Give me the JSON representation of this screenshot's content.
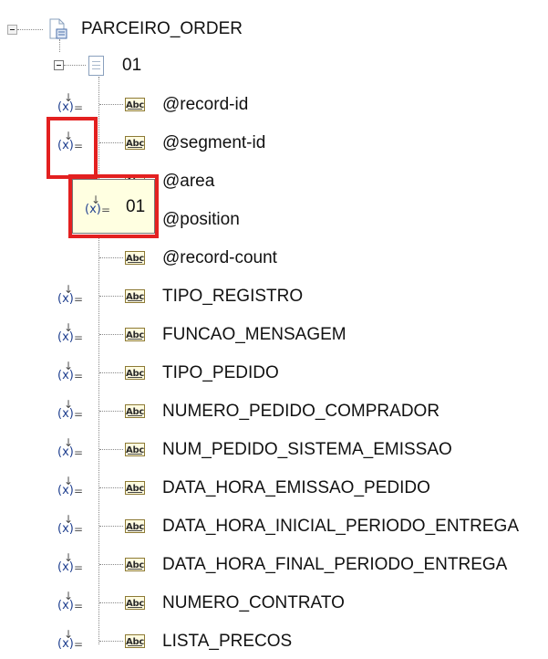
{
  "tree": {
    "root": {
      "label": "PARCEIRO_ORDER",
      "icon": "schema-document-icon"
    },
    "segment": {
      "label": "01",
      "icon": "document-icon",
      "expanded": true
    },
    "fields": [
      {
        "label": "@record-id",
        "mapped": true
      },
      {
        "label": "@segment-id",
        "mapped": true
      },
      {
        "label": "@area",
        "mapped": false
      },
      {
        "label": "@position",
        "mapped": false
      },
      {
        "label": "@record-count",
        "mapped": false
      },
      {
        "label": "TIPO_REGISTRO",
        "mapped": true
      },
      {
        "label": "FUNCAO_MENSAGEM",
        "mapped": true
      },
      {
        "label": "TIPO_PEDIDO",
        "mapped": true
      },
      {
        "label": "NUMERO_PEDIDO_COMPRADOR",
        "mapped": true
      },
      {
        "label": "NUM_PEDIDO_SISTEMA_EMISSAO",
        "mapped": true
      },
      {
        "label": "DATA_HORA_EMISSAO_PEDIDO",
        "mapped": true
      },
      {
        "label": "DATA_HORA_INICIAL_PERIODO_ENTREGA",
        "mapped": true
      },
      {
        "label": "DATA_HORA_FINAL_PERIODO_ENTREGA",
        "mapped": true
      },
      {
        "label": "NUMERO_CONTRATO",
        "mapped": true
      },
      {
        "label": "LISTA_PRECOS",
        "mapped": true
      }
    ],
    "field_icon": "text-field-abc-icon",
    "mapping_icon": "fixed-value-mapping-icon"
  },
  "tooltip": {
    "value": "01",
    "icon": "fixed-value-mapping-icon"
  },
  "highlight_color": "#e32020"
}
